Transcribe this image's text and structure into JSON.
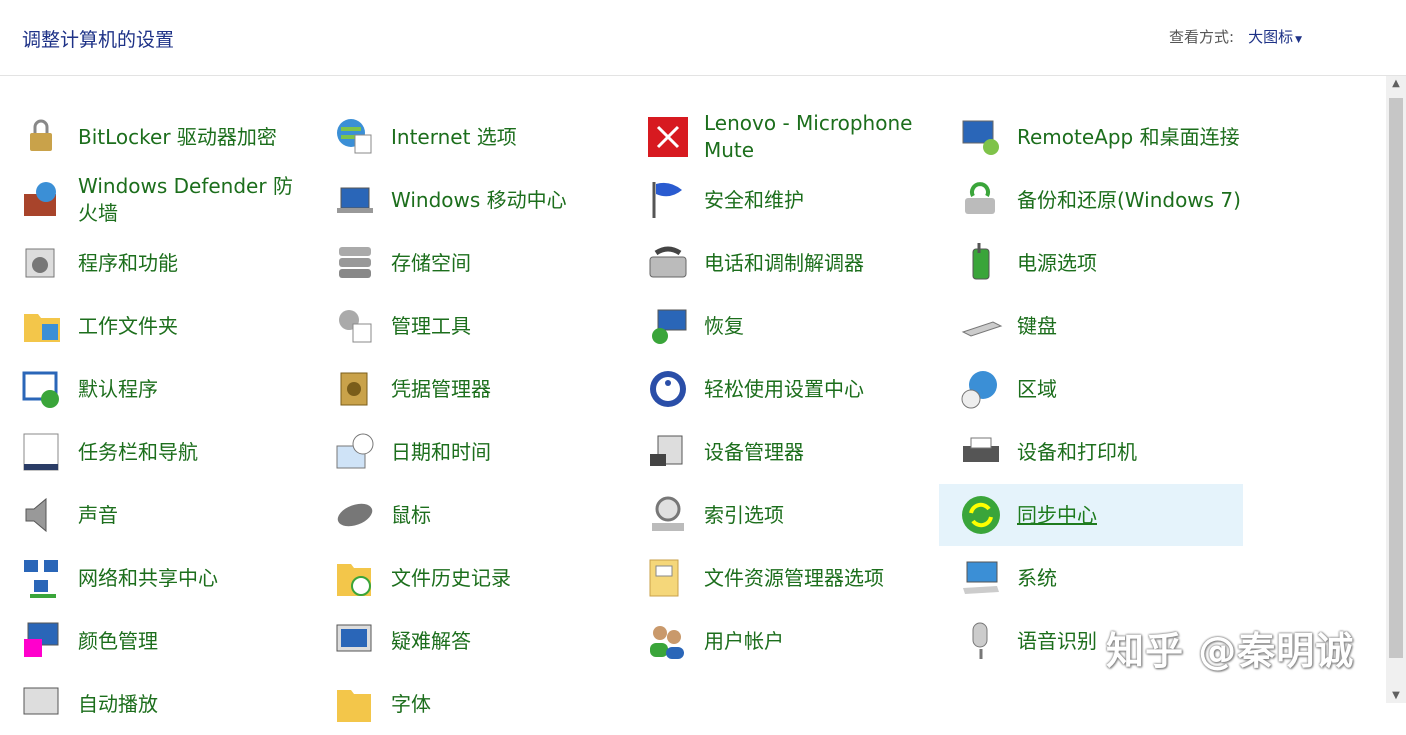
{
  "header": {
    "title": "调整计算机的设置",
    "view_by_label": "查看方式:",
    "view_by_value": "大图标"
  },
  "items": [
    {
      "label": "BitLocker 驱动器加密",
      "icon": "bitlocker-icon"
    },
    {
      "label": "Internet 选项",
      "icon": "internet-options-icon"
    },
    {
      "label": "Lenovo - Microphone Mute",
      "icon": "microphone-mute-icon"
    },
    {
      "label": "RemoteApp 和桌面连接",
      "icon": "remoteapp-icon"
    },
    {
      "label": "Windows Defender 防火墙",
      "icon": "firewall-icon"
    },
    {
      "label": "Windows 移动中心",
      "icon": "mobility-center-icon"
    },
    {
      "label": "安全和维护",
      "icon": "security-flag-icon"
    },
    {
      "label": "备份和还原(Windows 7)",
      "icon": "backup-icon"
    },
    {
      "label": "程序和功能",
      "icon": "programs-icon"
    },
    {
      "label": "存储空间",
      "icon": "storage-icon"
    },
    {
      "label": "电话和调制解调器",
      "icon": "phone-modem-icon"
    },
    {
      "label": "电源选项",
      "icon": "power-icon"
    },
    {
      "label": "工作文件夹",
      "icon": "work-folders-icon"
    },
    {
      "label": "管理工具",
      "icon": "admin-tools-icon"
    },
    {
      "label": "恢复",
      "icon": "recovery-icon"
    },
    {
      "label": "键盘",
      "icon": "keyboard-icon"
    },
    {
      "label": "默认程序",
      "icon": "default-programs-icon"
    },
    {
      "label": "凭据管理器",
      "icon": "credential-icon"
    },
    {
      "label": "轻松使用设置中心",
      "icon": "ease-of-access-icon"
    },
    {
      "label": "区域",
      "icon": "region-icon"
    },
    {
      "label": "任务栏和导航",
      "icon": "taskbar-icon"
    },
    {
      "label": "日期和时间",
      "icon": "date-time-icon"
    },
    {
      "label": "设备管理器",
      "icon": "device-manager-icon"
    },
    {
      "label": "设备和打印机",
      "icon": "printer-icon"
    },
    {
      "label": "声音",
      "icon": "sound-icon"
    },
    {
      "label": "鼠标",
      "icon": "mouse-icon"
    },
    {
      "label": "索引选项",
      "icon": "indexing-icon"
    },
    {
      "label": "同步中心",
      "icon": "sync-center-icon"
    },
    {
      "label": "网络和共享中心",
      "icon": "network-icon"
    },
    {
      "label": "文件历史记录",
      "icon": "file-history-icon"
    },
    {
      "label": "文件资源管理器选项",
      "icon": "explorer-options-icon"
    },
    {
      "label": "系统",
      "icon": "system-icon"
    },
    {
      "label": "颜色管理",
      "icon": "color-management-icon"
    },
    {
      "label": "疑难解答",
      "icon": "troubleshooting-icon"
    },
    {
      "label": "用户帐户",
      "icon": "user-accounts-icon"
    },
    {
      "label": "语音识别",
      "icon": "speech-recognition-icon"
    },
    {
      "label": "自动播放",
      "icon": "autoplay-icon"
    },
    {
      "label": "字体",
      "icon": "fonts-icon"
    }
  ],
  "hover_item": "同步中心",
  "watermark": "知乎 @秦明诚",
  "colors": {
    "link_green": "#1c6e1c",
    "title_blue": "#1e3287",
    "hover_bg": "#e5f3fb"
  }
}
